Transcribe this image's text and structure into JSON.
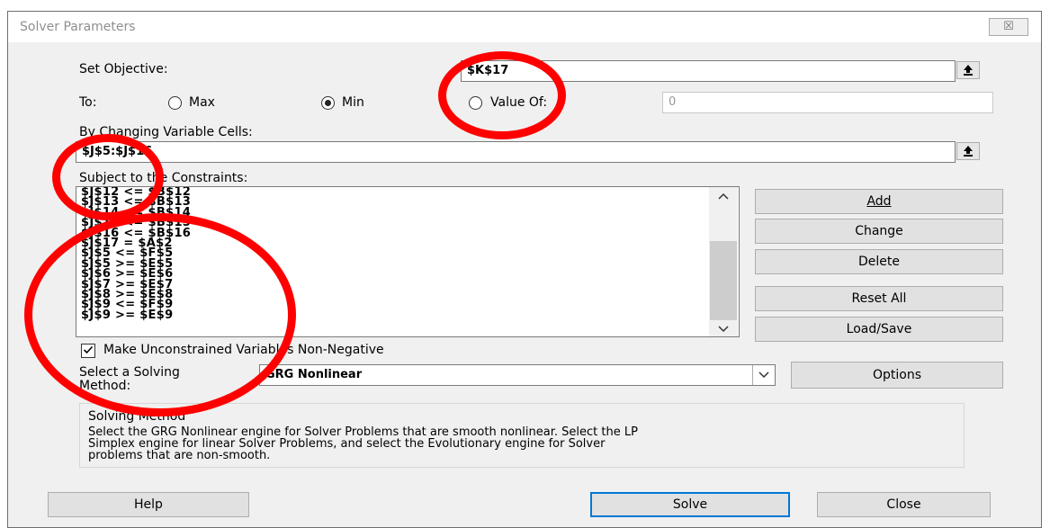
{
  "window": {
    "title": "Solver Parameters",
    "close_glyph": "☒"
  },
  "objective": {
    "label": "Set Objective:",
    "value": "$K$17"
  },
  "to": {
    "label": "To:",
    "max_label": "Max",
    "min_label": "Min",
    "value_of_label": "Value Of:",
    "selected": "Min",
    "value_of_value": "0"
  },
  "changing": {
    "label": "By Changing Variable Cells:",
    "value": "$J$5:$J$16"
  },
  "constraints": {
    "label": "Subject to the Constraints:",
    "items": [
      "$J$12 <= $B$12",
      "$J$13 <= $B$13",
      "$J$14 <= $B$14",
      "$J$15 <= $B$15",
      "$J$16 <= $B$16",
      "$J$17 = $A$2",
      "$J$5 <= $F$5",
      "$J$5 >= $E$5",
      "$J$6 >= $E$6",
      "$J$7 >= $E$7",
      "$J$8 >= $E$8",
      "$J$9 <= $F$9",
      "$J$9 >= $E$9"
    ]
  },
  "side_buttons": [
    "Add",
    "Change",
    "Delete",
    "Reset All",
    "Load/Save"
  ],
  "nonneg": {
    "label": "Make Unconstrained Variables Non-Negative",
    "checked": true
  },
  "method": {
    "label_line1": "Select a Solving",
    "label_line2": "Method:",
    "value": "GRG Nonlinear",
    "options_label": "Options"
  },
  "solving_method": {
    "heading": "Solving Method",
    "line1": "Select the GRG Nonlinear engine for Solver Problems that are smooth nonlinear. Select the LP",
    "line2": "Simplex engine for linear Solver Problems, and select the Evolutionary engine for Solver",
    "line3": "problems that are non-smooth."
  },
  "footer": {
    "help": "Help",
    "solve": "Solve",
    "close": "Close"
  },
  "colors": {
    "annotation_circle": "#ff0000",
    "default_button_border": "#0078d7"
  }
}
